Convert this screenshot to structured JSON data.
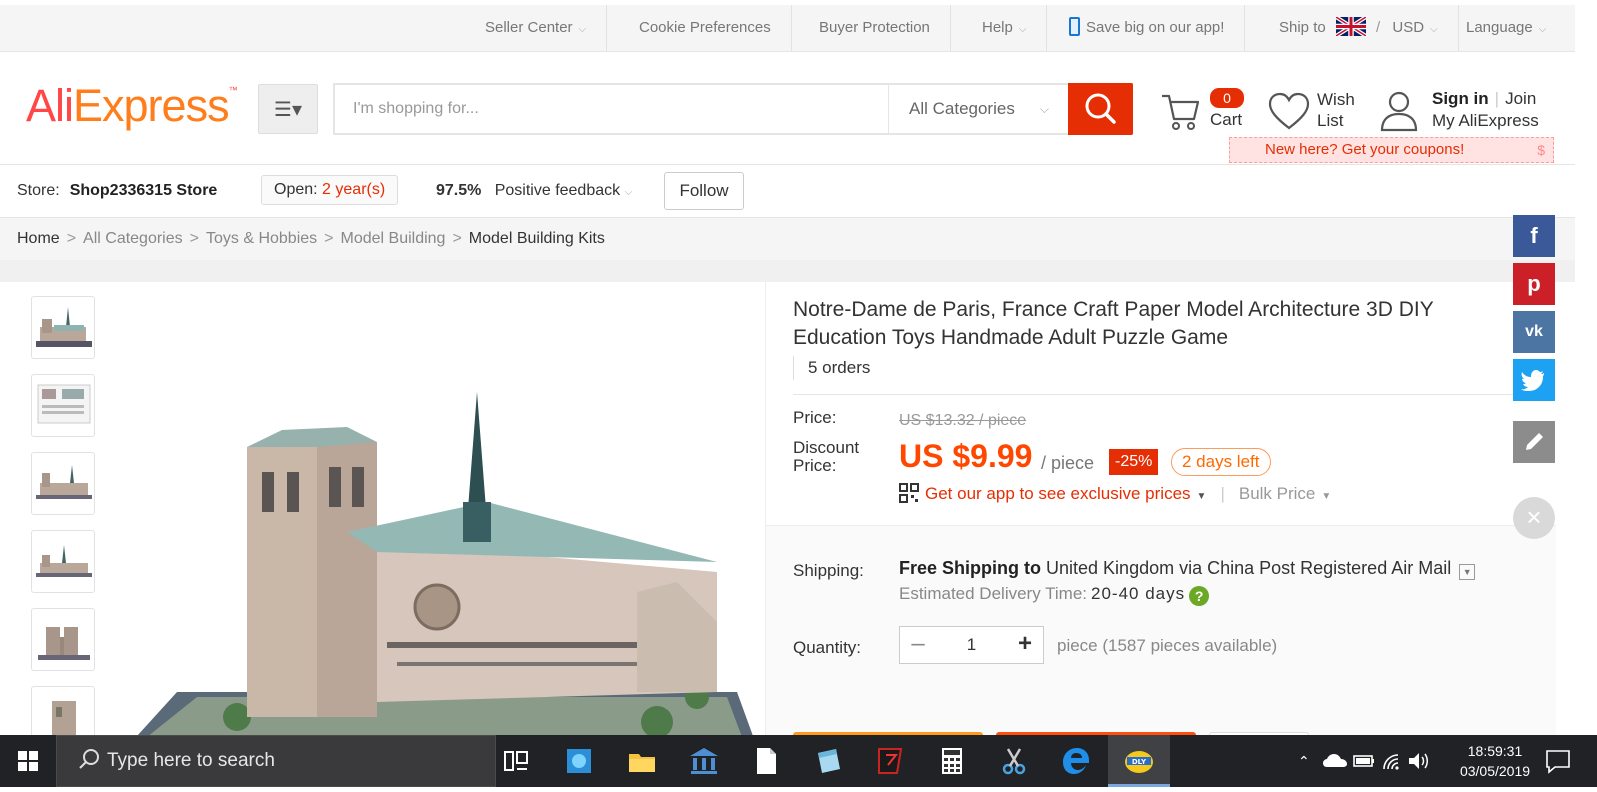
{
  "topbar": {
    "seller_center": "Seller Center",
    "cookie_preferences": "Cookie Preferences",
    "buyer_protection": "Buyer Protection",
    "help": "Help",
    "app_promo": "Save big on our app!",
    "ship_to": "Ship to",
    "currency": "USD",
    "language": "Language"
  },
  "header": {
    "logo_ali": "Ali",
    "logo_express": "Express",
    "logo_tm": "™",
    "search_placeholder": "I'm shopping for...",
    "search_category": "All Categories",
    "cart_count": "0",
    "cart_label": "Cart",
    "wish_line1": "Wish",
    "wish_line2": "List",
    "sign_in": "Sign in",
    "join": "Join",
    "my_account": "My AliExpress",
    "coupon_text": "New here? Get your coupons!",
    "coupon_symbol": "$"
  },
  "store": {
    "label": "Store:",
    "name": "Shop2336315 Store",
    "open_label": "Open:",
    "open_years": "2 year(s)",
    "feedback_pct": "97.5%",
    "feedback_label": "Positive feedback",
    "follow": "Follow"
  },
  "breadcrumb": [
    "Home",
    "All Categories",
    "Toys & Hobbies",
    "Model Building",
    "Model Building Kits"
  ],
  "product": {
    "title": "Notre-Dame de Paris, France Craft Paper Model Architecture 3D DIY Education Toys Handmade Adult Puzzle Game",
    "orders": "5 orders",
    "price_label": "Price:",
    "original_price": "US $13.32 / piece",
    "discount_label_1": "Discount",
    "discount_label_2": "Price:",
    "price": "US $9.99",
    "per_piece": "/ piece",
    "discount_pct": "-25%",
    "days_left": "2 days left",
    "app_price": "Get our app to see exclusive prices",
    "bulk_price": "Bulk Price",
    "shipping_label": "Shipping:",
    "free_shipping": "Free Shipping to",
    "shipping_dest": "United Kingdom via China Post Registered Air Mail",
    "eta_label": "Estimated Delivery Time:",
    "eta_days": "20-40 days",
    "eta_help": "?",
    "quantity_label": "Quantity:",
    "quantity": "1",
    "availability": "piece (1587 pieces available)",
    "thumbnail_count": 6
  },
  "social": [
    "facebook-icon",
    "pinterest-icon",
    "vk-icon",
    "twitter-icon",
    "edit-icon"
  ],
  "taskbar": {
    "search_placeholder": "Type here to search",
    "time": "18:59:31",
    "date": "03/05/2019"
  },
  "colors": {
    "brand_red": "#e62e04",
    "logo_orange": "#ff7d1a",
    "price_orange": "#ff4700",
    "facebook": "#3b5998",
    "pinterest": "#cb2027",
    "vk": "#4c75a3",
    "twitter": "#1da1f2",
    "edit": "#8c8c8c"
  }
}
